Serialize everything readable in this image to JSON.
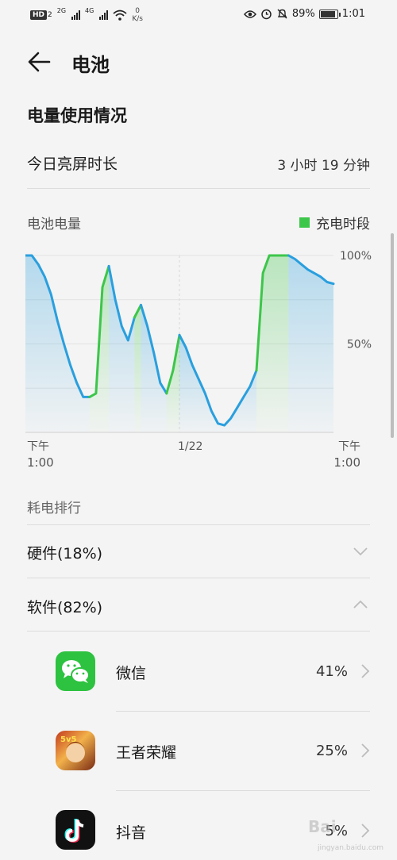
{
  "status_bar": {
    "hd": "HD",
    "hd_sub": "2",
    "net1": "2G",
    "net2": "4G",
    "speed_value": "0",
    "speed_unit": "K/s",
    "battery": "89%",
    "time": "1:01"
  },
  "header": {
    "title": "电池"
  },
  "usage": {
    "section_title": "电量使用情况",
    "screen_on_label": "今日亮屏时长",
    "screen_on_value": "3 小时 19 分钟"
  },
  "chart_data": {
    "type": "area",
    "title": "电池电量",
    "legend": [
      "充电时段"
    ],
    "ylim": [
      0,
      100
    ],
    "y_ticks": [
      "100%",
      "50%"
    ],
    "x_ticks": [
      [
        "下午",
        "1:00"
      ],
      [
        "1/22",
        ""
      ],
      [
        "下午",
        "1:00"
      ]
    ],
    "colors": {
      "discharge": "#2a9fde",
      "charge": "#3cc64a"
    },
    "x": [
      0,
      0.5,
      1,
      1.5,
      2,
      2.5,
      3,
      3.5,
      4,
      4.5,
      5,
      5.5,
      6,
      6.5,
      7,
      7.5,
      8,
      8.5,
      9,
      9.5,
      10,
      10.5,
      11,
      11.5,
      12,
      12.5,
      13,
      13.5,
      14,
      14.5,
      15,
      15.5,
      16,
      16.5,
      17,
      17.5,
      18,
      18.5,
      19,
      19.5,
      20,
      20.5,
      21,
      21.5,
      22,
      22.5,
      23,
      23.5,
      24
    ],
    "values": [
      100,
      100,
      95,
      88,
      78,
      63,
      50,
      38,
      28,
      20,
      20,
      22,
      82,
      94,
      75,
      60,
      52,
      65,
      72,
      60,
      45,
      28,
      22,
      35,
      55,
      48,
      38,
      30,
      22,
      12,
      5,
      4,
      8,
      14,
      20,
      26,
      35,
      90,
      100,
      100,
      100,
      100,
      98,
      95,
      92,
      90,
      88,
      85,
      84
    ],
    "segments": [
      {
        "kind": "discharge",
        "from": 0,
        "to": 10
      },
      {
        "kind": "charge",
        "from": 10,
        "to": 13
      },
      {
        "kind": "discharge",
        "from": 13,
        "to": 17
      },
      {
        "kind": "charge",
        "from": 17,
        "to": 18
      },
      {
        "kind": "discharge",
        "from": 18,
        "to": 22
      },
      {
        "kind": "charge",
        "from": 22,
        "to": 24
      },
      {
        "kind": "discharge",
        "from": 24,
        "to": 36
      },
      {
        "kind": "charge",
        "from": 36,
        "to": 41
      },
      {
        "kind": "discharge",
        "from": 41,
        "to": 48
      }
    ]
  },
  "ranking": {
    "title": "耗电排行",
    "hardware": "硬件(18%)",
    "software": "软件(82%)",
    "apps": [
      {
        "name": "微信",
        "percent": "41%"
      },
      {
        "name": "王者荣耀",
        "percent": "25%"
      },
      {
        "name": "抖音",
        "percent": "5%"
      }
    ]
  },
  "watermark": {
    "text": "Bai",
    "sub": "jingyan.baidu.com"
  }
}
